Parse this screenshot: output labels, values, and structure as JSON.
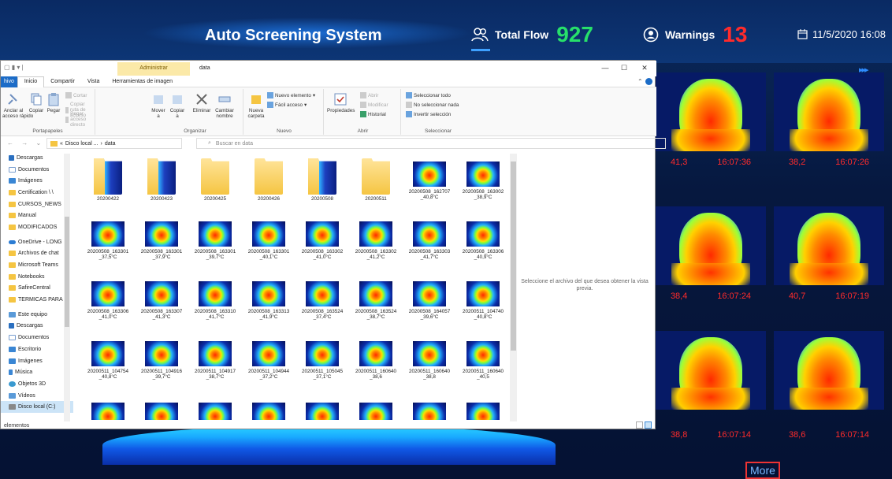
{
  "header": {
    "title": "Auto Screening System",
    "total_flow_label": "Total Flow",
    "total_flow_value": "927",
    "warnings_label": "Warnings",
    "warnings_value": "13",
    "datetime": "11/5/2020 16:08",
    "colors": {
      "flow": "#27e06a",
      "warnings": "#ff2b2b"
    }
  },
  "faces": [
    {
      "temp": "41,3",
      "time": "16:07:36"
    },
    {
      "temp": "38,2",
      "time": "16:07:26"
    },
    {
      "temp": "38,4",
      "time": "16:07:24"
    },
    {
      "temp": "40,7",
      "time": "16:07:19"
    },
    {
      "temp": "38,8",
      "time": "16:07:14"
    },
    {
      "temp": "38,6",
      "time": "16:07:14"
    }
  ],
  "more_label": "More",
  "explorer": {
    "admin_tab": "Administrar",
    "window_title": "data",
    "tabs": [
      "hivo",
      "Inicio",
      "Compartir",
      "Vista",
      "Herramientas de imagen"
    ],
    "ribbon": {
      "portapapeles": {
        "name": "Portapapeles",
        "anclar": "Anclar al\nacceso rápido",
        "copiar": "Copiar",
        "pegar": "Pegar",
        "cortar": "Cortar",
        "copiar_ruta": "Copiar ruta de acceso",
        "pegar_acceso": "Pegar acceso directo"
      },
      "organizar": {
        "name": "Organizar",
        "mover": "Mover\na",
        "copiar": "Copiar\na",
        "eliminar": "Eliminar",
        "cambiar": "Cambiar\nnombre"
      },
      "nuevo": {
        "name": "Nuevo",
        "nueva_carpeta": "Nueva\ncarpeta",
        "nuevo_elemento": "Nuevo elemento",
        "facil_acceso": "Fácil acceso"
      },
      "abrir": {
        "name": "Abrir",
        "propiedades": "Propiedades",
        "abrir": "Abrir",
        "modificar": "Modificar",
        "historial": "Historial"
      },
      "seleccionar": {
        "name": "Seleccionar",
        "todo": "Seleccionar todo",
        "nada": "No seleccionar nada",
        "invertir": "Invertir selección"
      }
    },
    "address": {
      "root": "«",
      "path1": "Disco local ...",
      "sep": "›",
      "path2": "data"
    },
    "search_placeholder": "Buscar en data",
    "nav_items": [
      {
        "label": "Descargas",
        "icon": "download-icon"
      },
      {
        "label": "Documentos",
        "icon": "document-icon"
      },
      {
        "label": "Imágenes",
        "icon": "image-icon"
      },
      {
        "label": "Certification \\ \\",
        "icon": "folder-icon"
      },
      {
        "label": "CURSOS_NEWS",
        "icon": "folder-icon"
      },
      {
        "label": "Manual",
        "icon": "folder-icon"
      },
      {
        "label": "MODIFICADOS",
        "icon": "folder-icon"
      },
      {
        "label": "OneDrive - LONG",
        "icon": "cloud-icon"
      },
      {
        "label": "Archivos de chat",
        "icon": "folder-icon"
      },
      {
        "label": "Microsoft Teams",
        "icon": "folder-icon"
      },
      {
        "label": "Notebooks",
        "icon": "folder-icon"
      },
      {
        "label": "SafireCentral",
        "icon": "folder-icon"
      },
      {
        "label": "TERMICAS PARA",
        "icon": "folder-icon"
      },
      {
        "label": "Este equipo",
        "icon": "computer-icon"
      },
      {
        "label": "Descargas",
        "icon": "download-icon"
      },
      {
        "label": "Documentos",
        "icon": "document-icon"
      },
      {
        "label": "Escritorio",
        "icon": "desktop-icon"
      },
      {
        "label": "Imágenes",
        "icon": "image-icon"
      },
      {
        "label": "Música",
        "icon": "music-icon"
      },
      {
        "label": "Objetos 3D",
        "icon": "cube-icon"
      },
      {
        "label": "Vídeos",
        "icon": "video-icon"
      },
      {
        "label": "Disco local (C:)",
        "icon": "drive-icon"
      }
    ],
    "files": [
      {
        "name": "20200422",
        "sub": "",
        "type": "folder-img"
      },
      {
        "name": "20200423",
        "sub": "",
        "type": "folder-img"
      },
      {
        "name": "20200425",
        "sub": "",
        "type": "folder"
      },
      {
        "name": "20200426",
        "sub": "",
        "type": "folder"
      },
      {
        "name": "20200508",
        "sub": "",
        "type": "folder-img"
      },
      {
        "name": "20200511",
        "sub": "",
        "type": "folder"
      },
      {
        "name": "20200508_162707",
        "sub": "_40,8°C",
        "type": "pic"
      },
      {
        "name": "20200508_163002",
        "sub": "_38,9°C",
        "type": "pic"
      },
      {
        "name": "20200508_163301",
        "sub": "_37,5°C",
        "type": "pic"
      },
      {
        "name": "20200508_163301",
        "sub": "_37,9°C",
        "type": "pic"
      },
      {
        "name": "20200508_163301",
        "sub": "_39,7°C",
        "type": "pic"
      },
      {
        "name": "20200508_163301",
        "sub": "_40,1°C",
        "type": "pic"
      },
      {
        "name": "20200508_163302",
        "sub": "_41,0°C",
        "type": "pic"
      },
      {
        "name": "20200508_163302",
        "sub": "_41,2°C",
        "type": "pic"
      },
      {
        "name": "20200508_163303",
        "sub": "_41,7°C",
        "type": "pic"
      },
      {
        "name": "20200508_163306",
        "sub": "_40,9°C",
        "type": "pic"
      },
      {
        "name": "20200508_163306",
        "sub": "_41,0°C",
        "type": "pic"
      },
      {
        "name": "20200508_163307",
        "sub": "_41,3°C",
        "type": "pic"
      },
      {
        "name": "20200508_163310",
        "sub": "_41,7°C",
        "type": "pic"
      },
      {
        "name": "20200508_163313",
        "sub": "_41,9°C",
        "type": "pic"
      },
      {
        "name": "20200508_163524",
        "sub": "_37,4°C",
        "type": "pic"
      },
      {
        "name": "20200508_163524",
        "sub": "_38,7°C",
        "type": "pic"
      },
      {
        "name": "20200508_164057",
        "sub": "_39,6°C",
        "type": "pic"
      },
      {
        "name": "20200511_104740",
        "sub": "_40,8°C",
        "type": "pic"
      },
      {
        "name": "20200511_104754",
        "sub": "_40,8°C",
        "type": "pic"
      },
      {
        "name": "20200511_104916",
        "sub": "_39,7°C",
        "type": "pic"
      },
      {
        "name": "20200511_104917",
        "sub": "_38,7°C",
        "type": "pic"
      },
      {
        "name": "20200511_104944",
        "sub": "_37,2°C",
        "type": "pic"
      },
      {
        "name": "20200511_105045",
        "sub": "_37,1°C",
        "type": "pic"
      },
      {
        "name": "20200511_160640",
        "sub": "_38,6",
        "type": "pic"
      },
      {
        "name": "20200511_160640",
        "sub": "_38,8",
        "type": "pic"
      },
      {
        "name": "20200511_160640",
        "sub": "_40,5",
        "type": "pic"
      },
      {
        "name": "",
        "sub": "",
        "type": "pic"
      },
      {
        "name": "",
        "sub": "",
        "type": "pic"
      },
      {
        "name": "",
        "sub": "",
        "type": "pic"
      },
      {
        "name": "",
        "sub": "",
        "type": "pic"
      },
      {
        "name": "",
        "sub": "",
        "type": "pic"
      },
      {
        "name": "",
        "sub": "",
        "type": "pic"
      },
      {
        "name": "",
        "sub": "",
        "type": "pic"
      },
      {
        "name": "",
        "sub": "",
        "type": "pic"
      }
    ],
    "preview_text": "Seleccione el archivo del que desea obtener la vista previa.",
    "status": "elementos"
  }
}
